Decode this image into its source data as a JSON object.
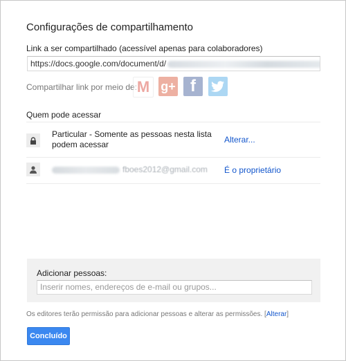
{
  "dialog": {
    "title": "Configurações de compartilhamento",
    "link_label": "Link a ser compartilhado (acessível apenas para colaboradores)",
    "link_value": "https://docs.google.com/document/d/"
  },
  "share_via": {
    "label": "Compartilhar link por meio de:",
    "networks": [
      {
        "name": "Gmail",
        "glyph": "M",
        "icon": "gmail-icon"
      },
      {
        "name": "Google+",
        "glyph": "g+",
        "icon": "google-plus-icon"
      },
      {
        "name": "Facebook",
        "glyph": "f",
        "icon": "facebook-icon"
      },
      {
        "name": "Twitter",
        "glyph": "t",
        "icon": "twitter-icon"
      }
    ]
  },
  "access": {
    "title": "Quem pode acessar",
    "rows": [
      {
        "icon": "lock-icon",
        "text_line1": "Particular - Somente as pessoas nesta lista",
        "text_line2": "podem acessar",
        "action": "Alterar..."
      },
      {
        "icon": "person-icon",
        "email": "fboes2012@gmail.com",
        "role": "É o proprietário"
      }
    ]
  },
  "add_people": {
    "label": "Adicionar pessoas:",
    "placeholder": "Inserir nomes, endereços de e-mail ou grupos..."
  },
  "footer": {
    "note_text": "Os editores terão permissão para adicionar pessoas e alterar as permissões.",
    "note_link": "Alterar",
    "done_label": "Concluído"
  }
}
